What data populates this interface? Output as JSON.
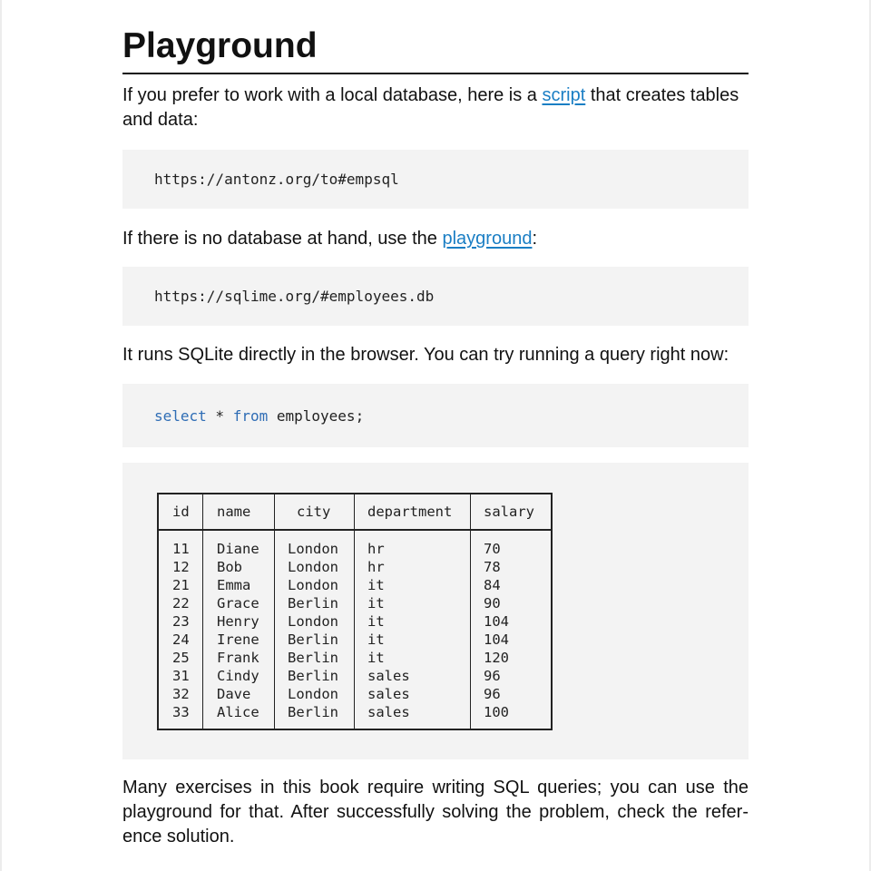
{
  "heading": "Playground",
  "p1": {
    "before": "If you prefer to work with a local database, here is a ",
    "link": "script",
    "after": " that creates tables and data:"
  },
  "code1": "https://antonz.org/to#empsql",
  "p2": {
    "before": "If there is no database at hand, use the ",
    "link": "playground",
    "after": ":"
  },
  "code2": "https://sqlime.org/#employees.db",
  "p3": "It runs SQLite directly in the browser. You can try running a query right now:",
  "query": {
    "kw1": "select",
    "star": " * ",
    "kw2": "from",
    "rest": " employees;"
  },
  "result": {
    "columns": [
      "id",
      "name",
      "city",
      "department",
      "salary"
    ],
    "rows": [
      [
        "11",
        "Diane",
        "London",
        "hr",
        "70"
      ],
      [
        "12",
        "Bob",
        "London",
        "hr",
        "78"
      ],
      [
        "21",
        "Emma",
        "London",
        "it",
        "84"
      ],
      [
        "22",
        "Grace",
        "Berlin",
        "it",
        "90"
      ],
      [
        "23",
        "Henry",
        "London",
        "it",
        "104"
      ],
      [
        "24",
        "Irene",
        "Berlin",
        "it",
        "104"
      ],
      [
        "25",
        "Frank",
        "Berlin",
        "it",
        "120"
      ],
      [
        "31",
        "Cindy",
        "Berlin",
        "sales",
        "96"
      ],
      [
        "32",
        "Dave",
        "London",
        "sales",
        "96"
      ],
      [
        "33",
        "Alice",
        "Berlin",
        "sales",
        "100"
      ]
    ]
  },
  "p4": "Many exercises in this book require writing SQL queries; you can use the playground for that. After successfully solving the problem, check the refer-ence solution.",
  "colors": {
    "link": "#1a7ec4",
    "keyword": "#2f6db5",
    "codeBackground": "#f3f3f3"
  }
}
